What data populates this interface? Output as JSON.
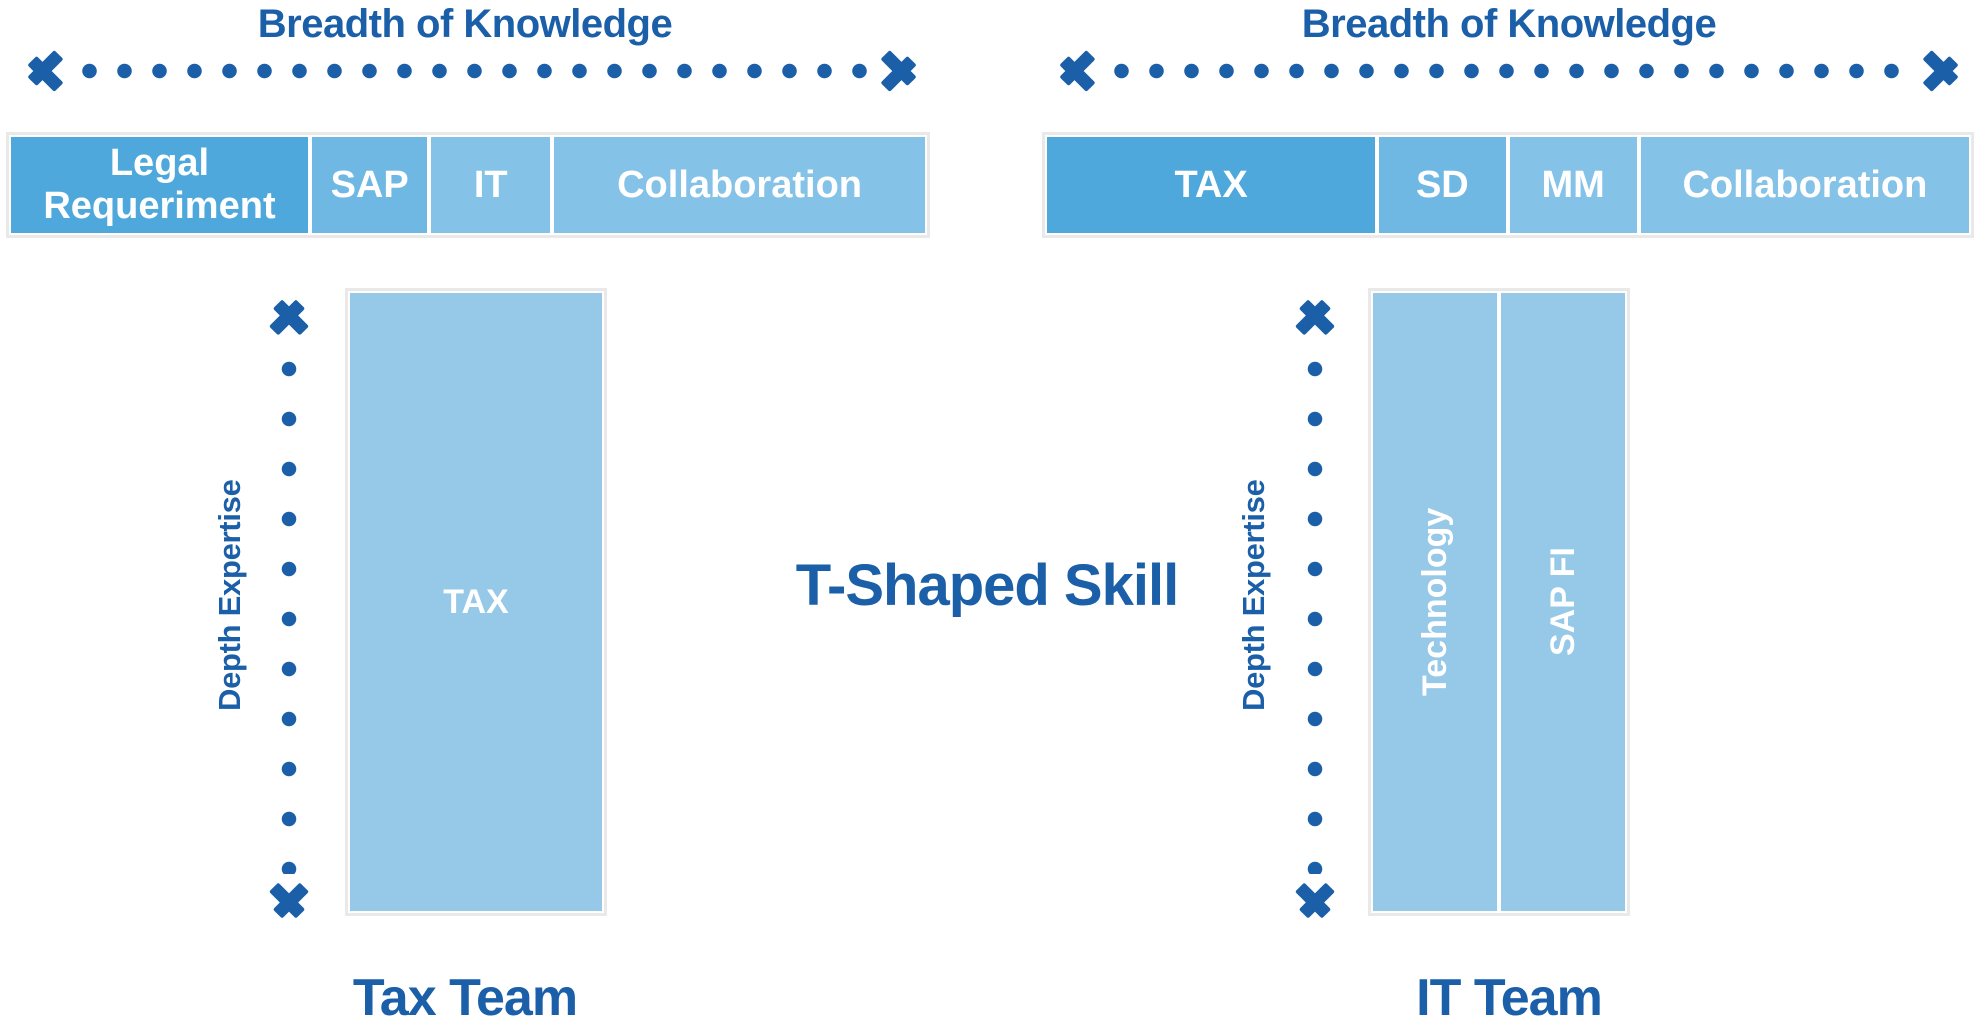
{
  "diagram": {
    "center_title": "T-Shaped Skill",
    "accent_dark_blue": "#1A5FA8",
    "tone_dark": "#4FA8DB",
    "tone_mid": "#6FB8E3",
    "tone_light": "#84C2E7",
    "tone_stem": "#96C8E8"
  },
  "left": {
    "breadth_label": "Breadth of Knowledge",
    "depth_label": "Depth Expertise",
    "team_label": "Tax Team",
    "breadth_segments": [
      {
        "label": "Legal Requeriment",
        "tone": "tone-dark",
        "flex": 265,
        "font": 38
      },
      {
        "label": "SAP",
        "tone": "tone-mid",
        "flex": 103,
        "font": 38
      },
      {
        "label": "IT",
        "tone": "tone-light",
        "flex": 106,
        "font": 38
      },
      {
        "label": "Collaboration",
        "tone": "tone-light",
        "flex": 331,
        "font": 38
      }
    ],
    "depth_segments": [
      {
        "label": "TAX",
        "tone": "tone-stem",
        "flex": 1,
        "font": 34
      }
    ]
  },
  "right": {
    "breadth_label": "Breadth of Knowledge",
    "depth_label": "Depth Expertise",
    "team_label": "IT Team",
    "breadth_segments": [
      {
        "label": "TAX",
        "tone": "tone-dark",
        "flex": 330,
        "font": 38
      },
      {
        "label": "SD",
        "tone": "tone-mid",
        "flex": 127,
        "font": 38
      },
      {
        "label": "MM",
        "tone": "tone-light",
        "flex": 128,
        "font": 38
      },
      {
        "label": "Collaboration",
        "tone": "tone-light",
        "flex": 330,
        "font": 38
      }
    ],
    "depth_segments": [
      {
        "label": "Technology",
        "tone": "tone-stem",
        "flex": 1,
        "font": 34
      },
      {
        "label": "SAP FI",
        "tone": "tone-stem",
        "flex": 1,
        "font": 34
      }
    ]
  }
}
